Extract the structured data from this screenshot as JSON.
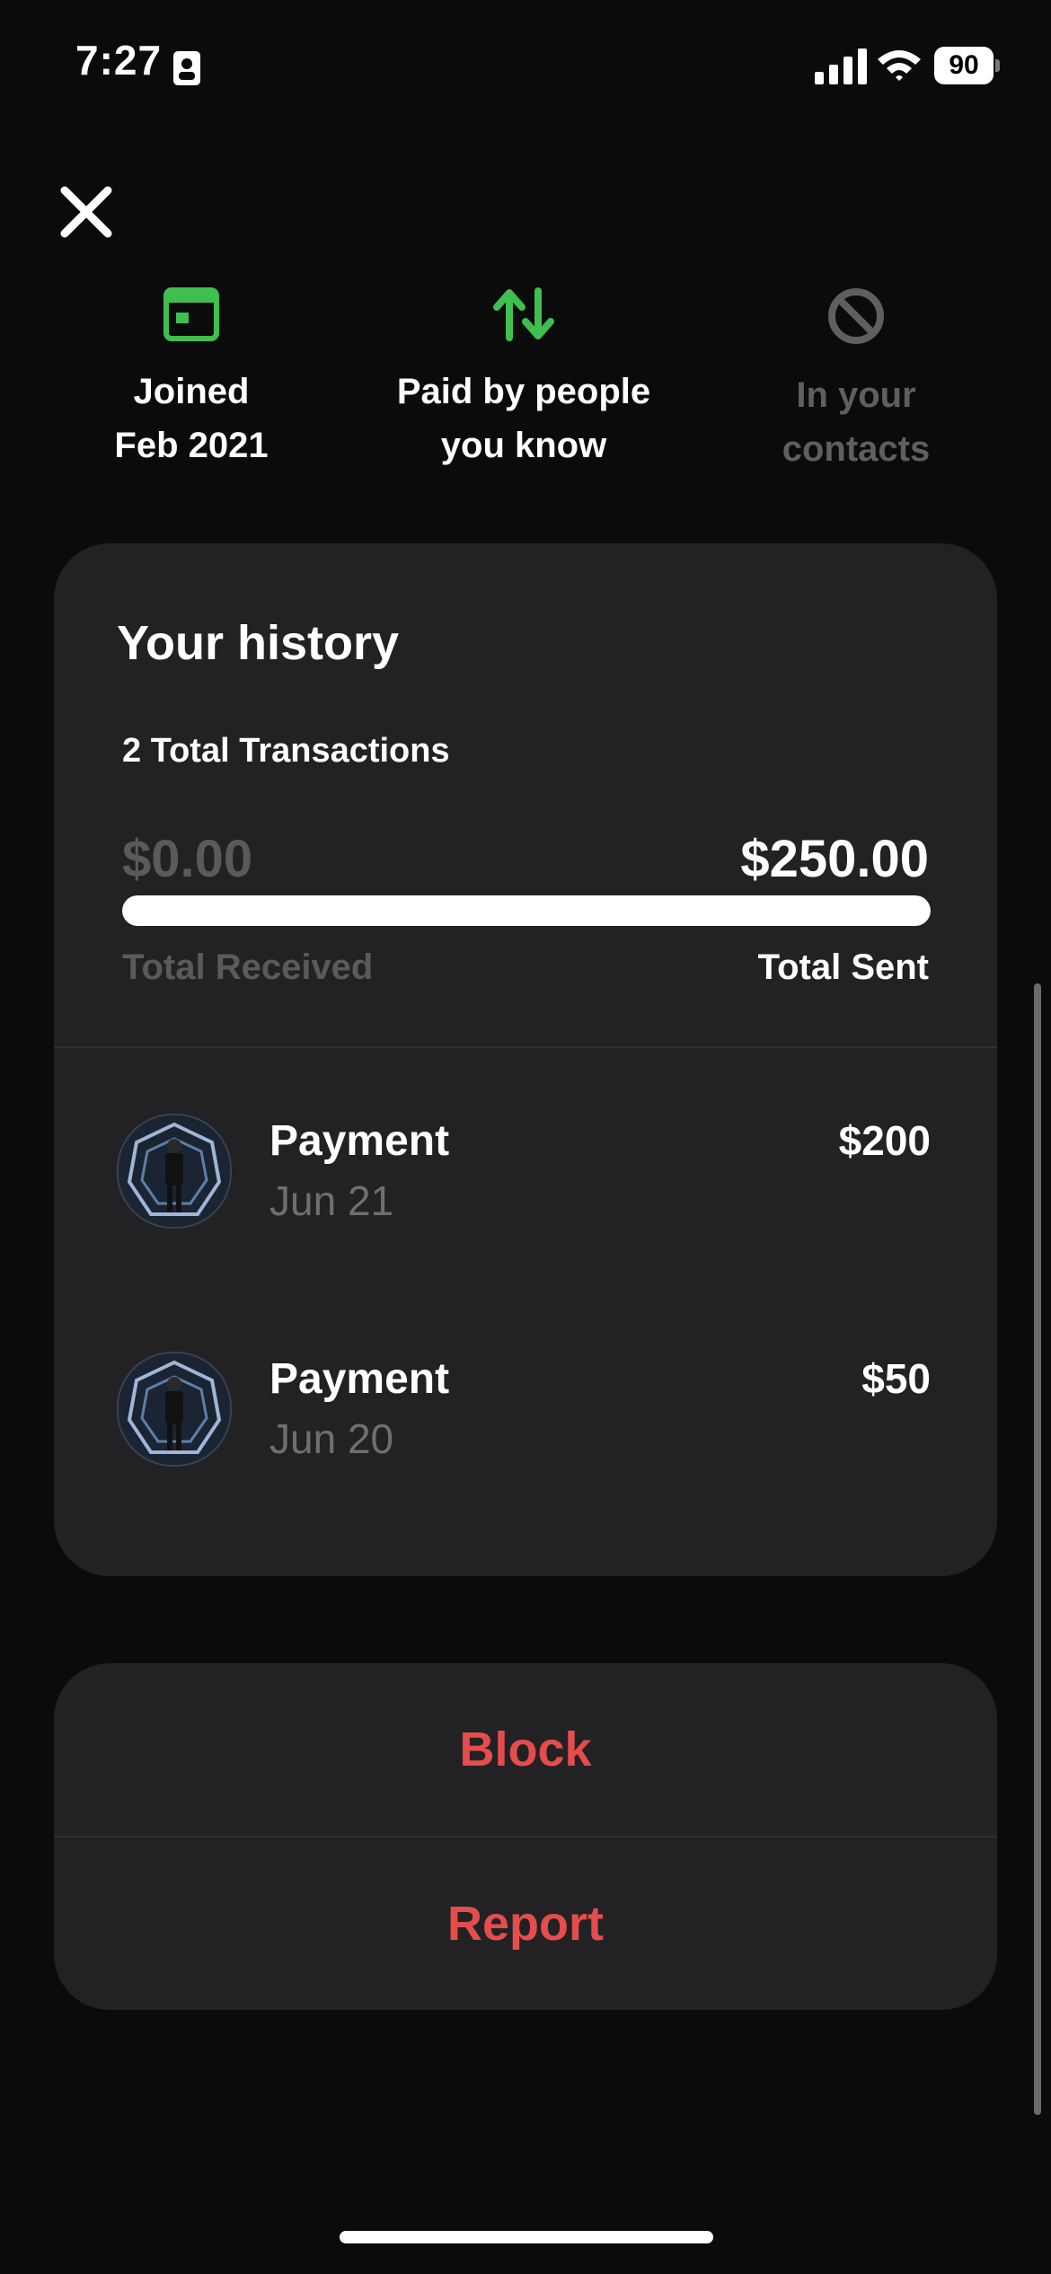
{
  "status_bar": {
    "time": "7:27",
    "battery": "90",
    "icons": [
      "id-card-icon",
      "cellular-signal-icon",
      "wifi-icon",
      "battery-icon"
    ]
  },
  "header": {
    "close_icon": "close-icon"
  },
  "highlights": [
    {
      "icon": "calendar-icon",
      "label": "Joined\nFeb 2021",
      "color": "#3fbf4f"
    },
    {
      "icon": "transfer-arrows-icon",
      "label": "Paid by people\nyou know",
      "color": "#3fbf4f"
    },
    {
      "icon": "blocked-icon",
      "label": "In your\ncontacts",
      "color": "#5f5f62"
    }
  ],
  "history": {
    "title": "Your history",
    "total_transactions": "2 Total Transactions",
    "total_received_amount": "$0.00",
    "total_sent_amount": "$250.00",
    "total_received_label": "Total Received",
    "total_sent_label": "Total Sent",
    "sent_share": 1.0,
    "transactions": [
      {
        "title": "Payment",
        "date": "Jun 21",
        "amount": "$200"
      },
      {
        "title": "Payment",
        "date": "Jun 20",
        "amount": "$50"
      }
    ]
  },
  "actions": {
    "block_label": "Block",
    "report_label": "Report",
    "color": "#e54d4d"
  },
  "theme": {
    "background": "#0b0b0c",
    "card": "#222225",
    "accent_green": "#3fbf4f",
    "muted": "#5a5a5d"
  }
}
